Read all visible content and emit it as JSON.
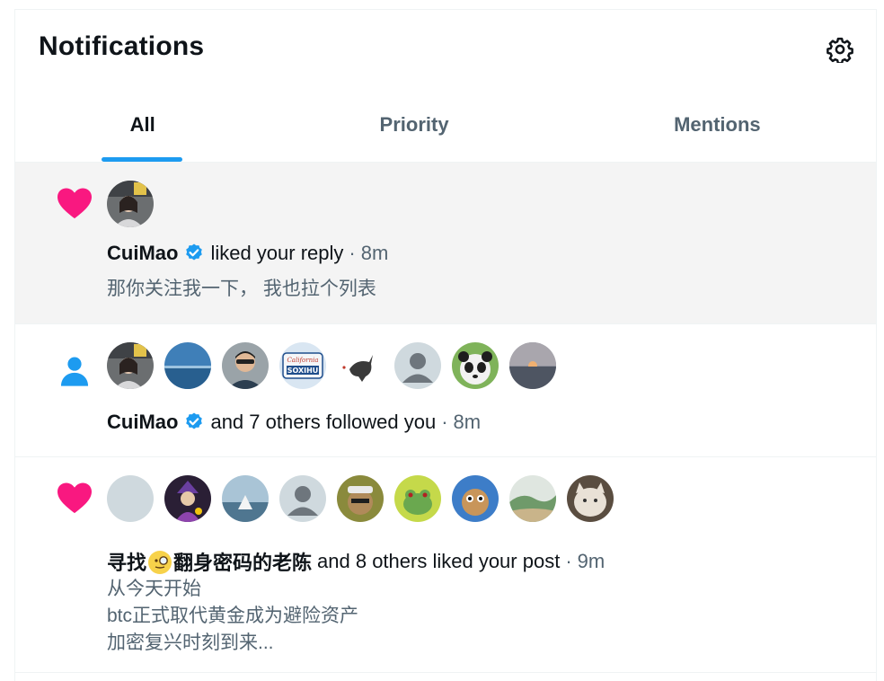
{
  "header": {
    "title": "Notifications",
    "settings_icon": "gear-icon"
  },
  "tabs": [
    {
      "label": "All",
      "active": true
    },
    {
      "label": "Priority",
      "active": false
    },
    {
      "label": "Mentions",
      "active": false
    }
  ],
  "notifications": [
    {
      "type": "like",
      "icon": "heart-icon",
      "icon_color": "#f91880",
      "avatar_count": 1,
      "actor": "CuiMao",
      "verified": true,
      "action": "liked your reply",
      "time": "8m",
      "content": [
        "那你关注我一下， 我也拉个列表"
      ]
    },
    {
      "type": "follow",
      "icon": "person-icon",
      "icon_color": "#1d9bf0",
      "avatar_count": 8,
      "actor": "CuiMao",
      "verified": true,
      "action": "and 7 others followed you",
      "time": "8m",
      "content": []
    },
    {
      "type": "like",
      "icon": "heart-icon",
      "icon_color": "#f91880",
      "avatar_count": 9,
      "actor_prefix": "寻找",
      "actor_suffix": "翻身密码的老陈",
      "actor_emoji": "magnifier-face-emoji",
      "action": "and 8 others liked your post",
      "time": "9m",
      "content": [
        "从今天开始",
        "btc正式取代黄金成为避险资产",
        "加密复兴时刻到来..."
      ]
    }
  ],
  "colors": {
    "accent": "#1d9bf0",
    "like": "#f91880",
    "muted_text": "#536471",
    "highlight_bg": "#f4f4f4"
  }
}
